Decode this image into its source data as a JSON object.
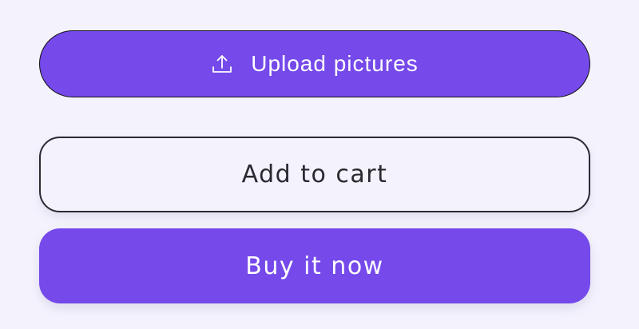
{
  "colors": {
    "accent": "#7549ea",
    "background": "#f4f3fd"
  },
  "upload_button": {
    "label": "Upload pictures",
    "icon": "upload-icon"
  },
  "cart_button": {
    "label": "Add to cart"
  },
  "buy_button": {
    "label": "Buy it now"
  }
}
